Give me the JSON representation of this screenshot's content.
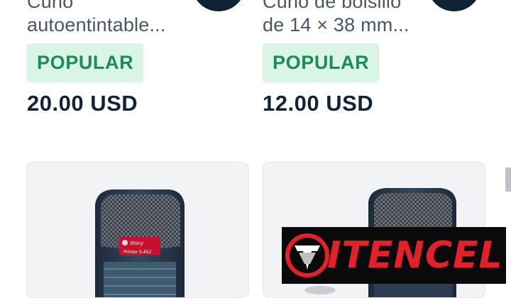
{
  "products_top": [
    {
      "title_line1": "Cuño",
      "title_line2": "autoentintable...",
      "badge": "POPULAR",
      "price": "20.00 USD"
    },
    {
      "title_line1": "Cuño de bolsillo",
      "title_line2": "de 14 × 38 mm...",
      "badge": "POPULAR",
      "price": "12.00 USD"
    }
  ],
  "stamp_label": {
    "brand": "Shiny",
    "model": "Printer S-852"
  },
  "watermark": {
    "brand": "ITENCEL"
  },
  "colors": {
    "badge_bg": "#d9f5e5",
    "badge_text": "#1e8a55",
    "price_text": "#122335",
    "circle_button": "#0f2236",
    "logo_red": "#e4202a"
  }
}
